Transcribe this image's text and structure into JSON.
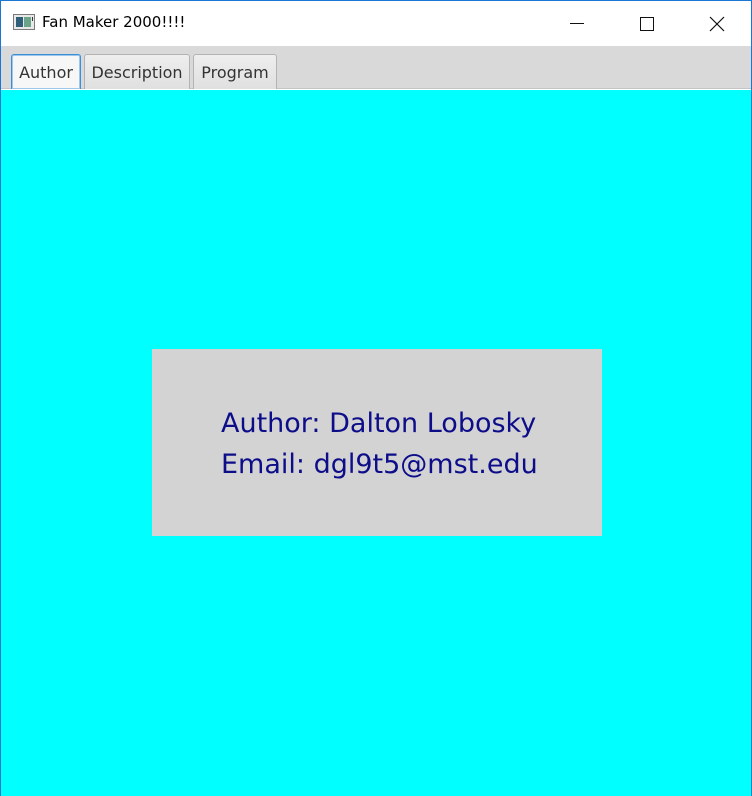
{
  "window": {
    "title": "Fan Maker 2000!!!!",
    "icon": "app-window-icon",
    "controls": {
      "minimize_icon": "minimize-icon",
      "maximize_icon": "maximize-icon",
      "close_icon": "close-icon"
    }
  },
  "tabs": [
    {
      "label": "Author",
      "selected": true
    },
    {
      "label": "Description",
      "selected": false
    },
    {
      "label": "Program",
      "selected": false
    }
  ],
  "content": {
    "background_color": "#00ffff",
    "panel_color": "#d3d3d3",
    "text_color": "#0d0d8a",
    "author_line": "Author: Dalton Lobosky",
    "email_line": "Email: dgl9t5@mst.edu"
  }
}
